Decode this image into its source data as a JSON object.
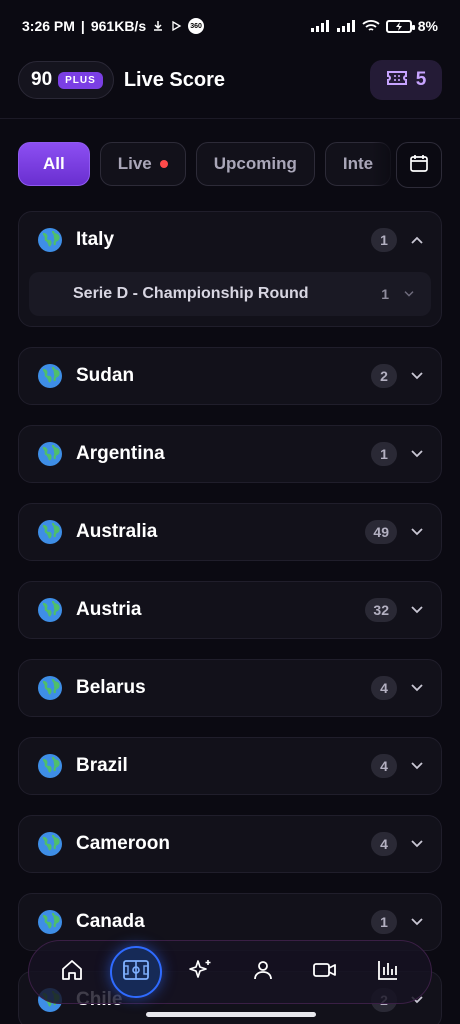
{
  "status_bar": {
    "time": "3:26 PM",
    "network_speed": "961KB/s",
    "battery": "8%",
    "ring_label": "360"
  },
  "header": {
    "brand_number": "90",
    "plus_label": "PLUS",
    "title": "Live Score",
    "ticket_count": "5"
  },
  "filters": {
    "tabs": [
      "All",
      "Live",
      "Upcoming",
      "Inte"
    ],
    "active": "All"
  },
  "countries": [
    {
      "name": "Italy",
      "count": "1",
      "expanded": true,
      "leagues": [
        {
          "name": "Serie D - Championship Round",
          "count": "1"
        }
      ]
    },
    {
      "name": "Sudan",
      "count": "2"
    },
    {
      "name": "Argentina",
      "count": "1"
    },
    {
      "name": "Australia",
      "count": "49"
    },
    {
      "name": "Austria",
      "count": "32"
    },
    {
      "name": "Belarus",
      "count": "4"
    },
    {
      "name": "Brazil",
      "count": "4"
    },
    {
      "name": "Cameroon",
      "count": "4"
    },
    {
      "name": "Canada",
      "count": "1"
    },
    {
      "name": "Chile",
      "count": "2"
    }
  ],
  "bottom_nav": {
    "items": [
      "home-icon",
      "football-pitch-icon",
      "sparkles-icon",
      "profile-icon",
      "video-icon",
      "stats-icon"
    ],
    "active": "football-pitch-icon"
  },
  "colors": {
    "accent_purple": "#7b3fe4",
    "live_red": "#ff4a4a",
    "active_nav_blue": "#2f6bff",
    "background": "#0b0a12"
  }
}
